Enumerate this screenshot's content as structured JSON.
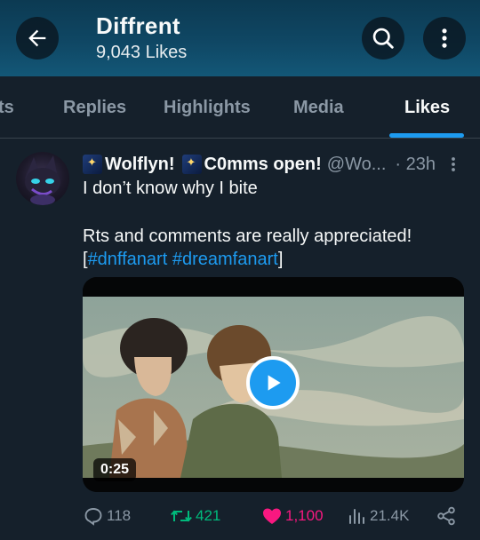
{
  "header": {
    "title": "Diffrent",
    "likes_count": "9,043 Likes",
    "icons": {
      "back": "arrow-left-icon",
      "search": "search-icon",
      "more": "more-vertical-icon"
    }
  },
  "tabs": [
    {
      "label": "ts",
      "active": false
    },
    {
      "label": "Replies",
      "active": false
    },
    {
      "label": "Highlights",
      "active": false
    },
    {
      "label": "Media",
      "active": false
    },
    {
      "label": "Likes",
      "active": true
    }
  ],
  "post": {
    "author_name": "Wolflyn!",
    "author_name_2": "C0mms open!",
    "handle": "@Wo...",
    "time": "· 23h",
    "text_line1": "I don’t know why I bite",
    "text_line2": "Rts and comments are really appreciated!",
    "text_line3_open": "[",
    "hashtag1": "#dnffanart",
    "hashtag2": "#dreamfanart",
    "text_line3_close": "]",
    "video_duration": "0:25",
    "replies": "118",
    "retweets": "421",
    "likes": "1,100",
    "views": "21.4K"
  },
  "colors": {
    "accent": "#1d9bf0",
    "background": "#15202b",
    "retweet": "#00ba7c",
    "like": "#f91880",
    "muted": "#8b98a5"
  }
}
